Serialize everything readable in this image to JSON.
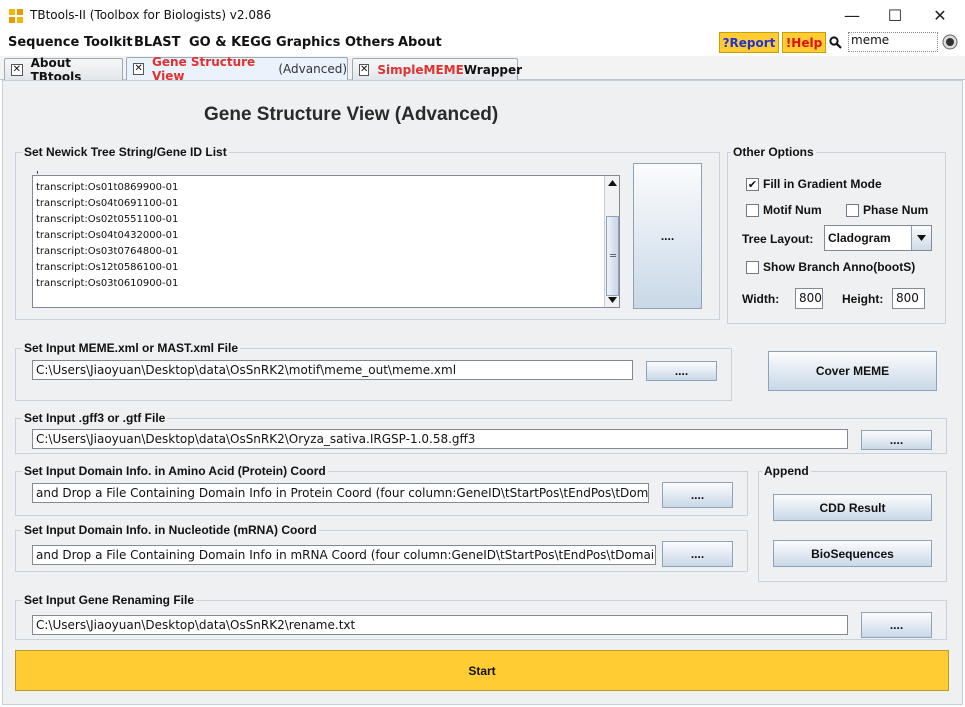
{
  "window": {
    "title": "TBtools-II (Toolbox for Biologists) v2.086",
    "minimize": "—",
    "maximize": "☐",
    "close": "✕"
  },
  "menu": {
    "items": [
      "Sequence Toolkit",
      "BLAST",
      "GO & KEGG",
      "Graphics",
      "Others",
      "About"
    ],
    "report_label": "?Report",
    "help_label": "!Help",
    "search_value": "meme"
  },
  "tabs": [
    {
      "label": "About TBtools"
    },
    {
      "label_pre": "Gene Structure View",
      "label_post": " (Advanced)"
    },
    {
      "label_pre": "Simple ",
      "label_mid": "MEME",
      "label_post": " Wrapper"
    }
  ],
  "page_title": "Gene Structure View (Advanced)",
  "newick_group": {
    "label": "Set Newick Tree String/Gene ID List",
    "items": [
      "transcript:Os01t0869900-01",
      "transcript:Os04t0691100-01",
      "transcript:Os02t0551100-01",
      "transcript:Os04t0432000-01",
      "transcript:Os03t0764800-01",
      "transcript:Os12t0586100-01",
      "transcript:Os03t0610900-01"
    ],
    "browse_label": "...."
  },
  "other_options": {
    "label": "Other Options",
    "gradient_label": "Fill in Gradient Mode",
    "gradient_checked": true,
    "motif_label": "Motif Num",
    "phase_label": "Phase Num",
    "tree_layout_label": "Tree Layout:",
    "tree_layout_value": "Cladogram",
    "branch_label": "Show Branch Anno(bootS)",
    "width_label": "Width:",
    "width_value": "800",
    "height_label": "Height:",
    "height_value": "800"
  },
  "meme_group": {
    "label": "Set Input MEME.xml or MAST.xml File",
    "value": "C:\\Users\\Jiaoyuan\\Desktop\\data\\OsSnRK2\\motif\\meme_out\\meme.xml",
    "browse_label": "....",
    "cover_label": "Cover MEME"
  },
  "gff_group": {
    "label": "Set Input .gff3 or .gtf File",
    "value": "C:\\Users\\Jiaoyuan\\Desktop\\data\\OsSnRK2\\Oryza_sativa.IRGSP-1.0.58.gff3",
    "browse_label": "...."
  },
  "protein_domain_group": {
    "label": "Set Input Domain Info. in Amino Acid (Protein) Coord",
    "value": "and Drop a File Containing Domain Info in Protein Coord (four column:GeneID\\tStartPos\\tEndPos\\tDomainName)",
    "browse_label": "...."
  },
  "mrna_domain_group": {
    "label": "Set Input Domain Info. in Nucleotide (mRNA) Coord",
    "value": " and Drop a File Containing Domain Info in mRNA Coord (four column:GeneID\\tStartPos\\tEndPos\\tDomainName)",
    "browse_label": "...."
  },
  "append_group": {
    "label": "Append",
    "cdd_label": "CDD Result",
    "bioseq_label": "BioSequences"
  },
  "rename_group": {
    "label": "Set Input Gene Renaming File",
    "value": "C:\\Users\\Jiaoyuan\\Desktop\\data\\OsSnRK2\\rename.txt",
    "browse_label": "...."
  },
  "start_label": "Start"
}
